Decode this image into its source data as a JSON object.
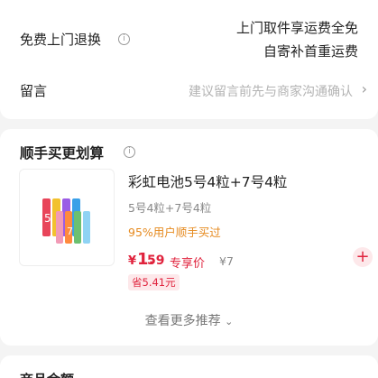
{
  "shipping": {
    "label": "免费上门退换",
    "info_icon": "info-icon",
    "line1": "上门取件享运费全免",
    "line2": "自寄补首重运费"
  },
  "note": {
    "label": "留言",
    "placeholder": "建议留言前先与商家沟通确认",
    "chevron": "chevron-right-icon"
  },
  "deals": {
    "title": "顺手买更划算",
    "info_icon": "info-icon",
    "product": {
      "name": "彩虹电池5号4粒+7号4粒",
      "spec": "5号4粒+7号4粒",
      "sold": "95%用户顺手买过",
      "price_symbol": "¥",
      "price_int": "1.",
      "price_dec": "59",
      "price_tag": "专享价",
      "original_price": "¥7",
      "save": "省5.41元",
      "add_icon": "plus-icon"
    },
    "more": "查看更多推荐",
    "more_icon": "chevron-down-icon"
  },
  "bottom": {
    "title": "商品金额"
  },
  "colors": {
    "accent_red": "#e0233d",
    "orange": "#e68a1f",
    "background": "#f4f4f4"
  }
}
